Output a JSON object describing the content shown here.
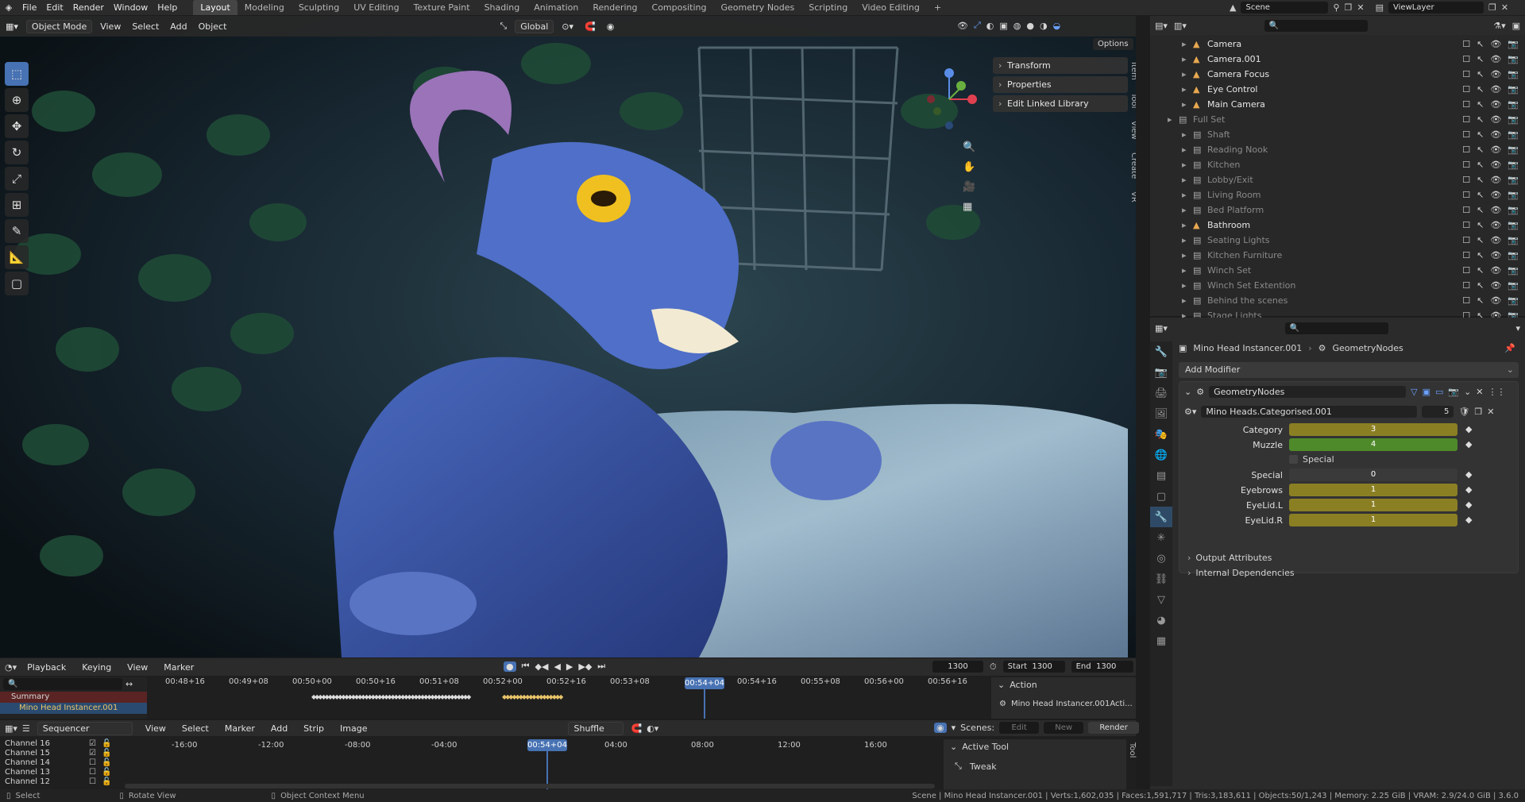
{
  "topbar": {
    "menus": [
      "File",
      "Edit",
      "Render",
      "Window",
      "Help"
    ],
    "workspaces": [
      "Layout",
      "Modeling",
      "Sculpting",
      "UV Editing",
      "Texture Paint",
      "Shading",
      "Animation",
      "Rendering",
      "Compositing",
      "Geometry Nodes",
      "Scripting",
      "Video Editing"
    ],
    "active_workspace": "Layout",
    "scene": "Scene",
    "view_layer": "ViewLayer"
  },
  "viewport": {
    "mode": "Object Mode",
    "menus": [
      "View",
      "Select",
      "Add",
      "Object"
    ],
    "orientation": "Global",
    "options": "Options",
    "npanel": [
      "Transform",
      "Properties",
      "Edit Linked Library"
    ],
    "side_tabs": [
      "Item",
      "Tool",
      "View",
      "Create",
      "VR"
    ]
  },
  "outliner": {
    "items": [
      {
        "name": "Camera",
        "indent": 1,
        "dim": false
      },
      {
        "name": "Camera.001",
        "indent": 1,
        "dim": false
      },
      {
        "name": "Camera Focus",
        "indent": 1,
        "dim": false
      },
      {
        "name": "Eye Control",
        "indent": 1,
        "dim": false
      },
      {
        "name": "Main Camera",
        "indent": 1,
        "dim": false
      },
      {
        "name": "Full Set",
        "indent": 0,
        "dim": true
      },
      {
        "name": "Shaft",
        "indent": 1,
        "dim": true
      },
      {
        "name": "Reading Nook",
        "indent": 1,
        "dim": true
      },
      {
        "name": "Kitchen",
        "indent": 1,
        "dim": true
      },
      {
        "name": "Lobby/Exit",
        "indent": 1,
        "dim": true
      },
      {
        "name": "Living Room",
        "indent": 1,
        "dim": true
      },
      {
        "name": "Bed Platform",
        "indent": 1,
        "dim": true
      },
      {
        "name": "Bathroom",
        "indent": 1,
        "dim": false
      },
      {
        "name": "Seating Lights",
        "indent": 1,
        "dim": true
      },
      {
        "name": "Kitchen Furniture",
        "indent": 1,
        "dim": true
      },
      {
        "name": "Winch Set",
        "indent": 1,
        "dim": true
      },
      {
        "name": "Winch Set Extention",
        "indent": 1,
        "dim": true
      },
      {
        "name": "Behind the scenes",
        "indent": 1,
        "dim": true
      },
      {
        "name": "Stage Lights",
        "indent": 1,
        "dim": true
      }
    ]
  },
  "properties": {
    "object": "Mino Head Instancer.001",
    "modifier_path": "GeometryNodes",
    "add_modifier": "Add Modifier",
    "modifier_name": "GeometryNodes",
    "node_group": "Mino Heads.Categorised.001",
    "users": "5",
    "fields": [
      {
        "label": "Category",
        "value": "3",
        "color": "#8b7f24"
      },
      {
        "label": "Muzzle",
        "value": "4",
        "color": "#4f8a2a"
      },
      {
        "label": "Special",
        "value": "0",
        "color": "#3a3a3a"
      },
      {
        "label": "Eyebrows",
        "value": "1",
        "color": "#8b7f24"
      },
      {
        "label": "EyeLid.L",
        "value": "1",
        "color": "#8b7f24"
      },
      {
        "label": "EyeLid.R",
        "value": "1",
        "color": "#8b7f24"
      }
    ],
    "special_checkbox": "Special",
    "sections": [
      "Output Attributes",
      "Internal Dependencies"
    ]
  },
  "timeline": {
    "menus": [
      "Playback",
      "Keying",
      "View",
      "Marker"
    ],
    "frame": "1300",
    "start_label": "Start",
    "start": "1300",
    "end_label": "End",
    "end": "1300",
    "ticks": [
      "00:48+16",
      "00:49+08",
      "00:50+00",
      "00:50+16",
      "00:51+08",
      "00:52+00",
      "00:52+16",
      "00:53+08",
      "00:54+16",
      "00:55+08",
      "00:56+00",
      "00:56+16"
    ],
    "current_time": "00:54+04",
    "summary": "Summary",
    "object_row": "Mino Head Instancer.001",
    "action_header": "Action",
    "action_name": "Mino Head Instancer.001Acti..."
  },
  "sequencer": {
    "type": "Sequencer",
    "menus": [
      "View",
      "Select",
      "Marker",
      "Add",
      "Strip",
      "Image"
    ],
    "shuffle": "Shuffle",
    "scenes_label": "Scenes:",
    "edit": "Edit",
    "new": "New",
    "render": "Render",
    "channels": [
      "Channel 16",
      "Channel 15",
      "Channel 14",
      "Channel 13",
      "Channel 12"
    ],
    "ticks": [
      "-16:00",
      "-12:00",
      "-08:00",
      "-04:00",
      "04:00",
      "08:00",
      "12:00",
      "16:00"
    ],
    "current_time": "00:54+04",
    "active_tool": "Active Tool",
    "tweak": "Tweak",
    "tool_tab": "Tool"
  },
  "status": {
    "select": "Select",
    "rotate": "Rotate View",
    "context": "Object Context Menu",
    "info": "Scene | Mino Head Instancer.001 | Verts:1,602,035 | Faces:1,591,717 | Tris:3,183,611 | Objects:50/1,243 | Memory: 2.25 GiB | VRAM: 2.9/24.0 GiB | 3.6.0"
  }
}
